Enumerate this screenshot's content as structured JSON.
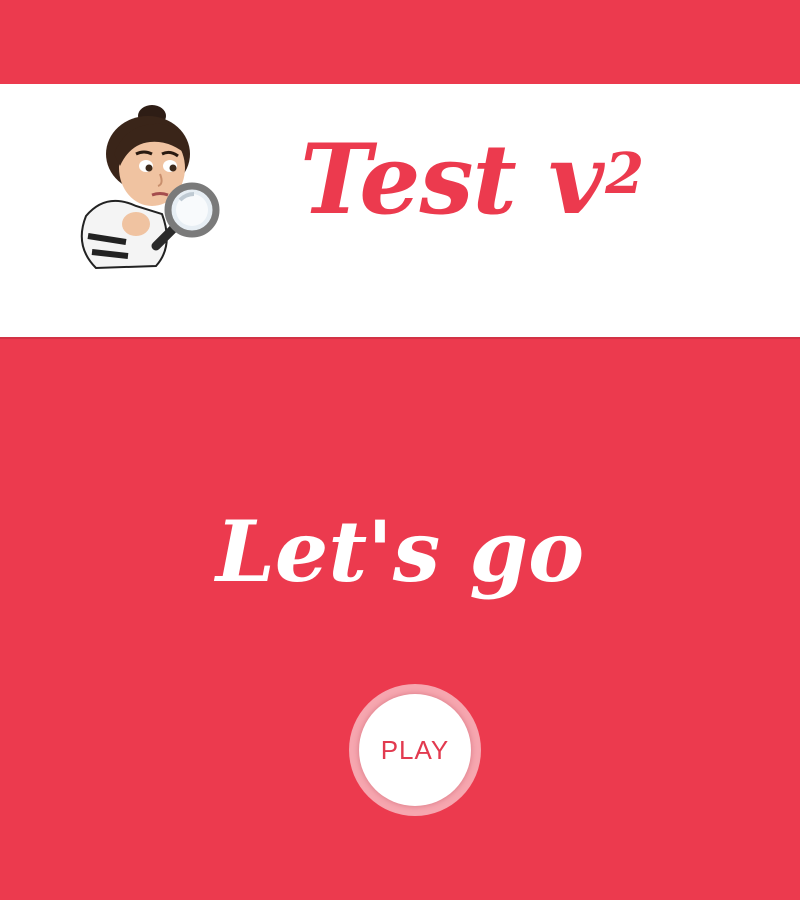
{
  "colors": {
    "background": "#ec3a4e",
    "banner": "#ffffff",
    "accent": "#ec3a4e",
    "headline_text": "#ffffff",
    "play_ring": "#f6a6af"
  },
  "header": {
    "avatar_icon": "detective-avatar-with-magnifying-glass-icon",
    "title": "Test v",
    "title_superscript": "2"
  },
  "main": {
    "headline": "Let's go",
    "play_label": "PLAY"
  }
}
